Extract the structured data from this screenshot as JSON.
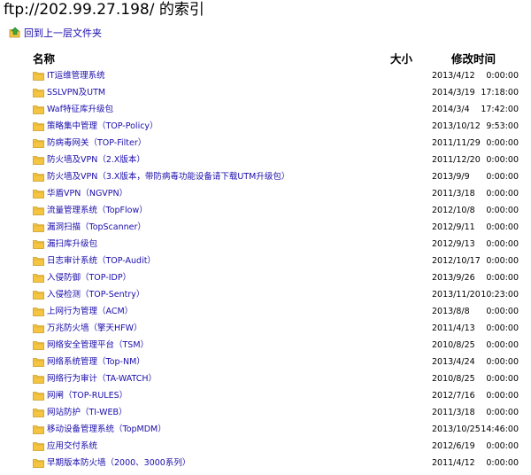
{
  "page": {
    "title": "ftp://202.99.27.198/ 的索引",
    "up_label": "回到上一层文件夹"
  },
  "columns": {
    "name": "名称",
    "size": "大小",
    "modified": "修改时间"
  },
  "icons": {
    "folder": "folder-icon",
    "up": "parent-folder-icon",
    "folder_color": "#f5c542",
    "link_color": "#1a0dab"
  },
  "rows": [
    {
      "name": "IT运维管理系统",
      "date": "2013/4/12",
      "time": "0:00:00"
    },
    {
      "name": "SSLVPN及UTM",
      "date": "2014/3/19",
      "time": "17:18:00"
    },
    {
      "name": "Waf特征库升级包",
      "date": "2014/3/4",
      "time": "17:42:00"
    },
    {
      "name": "策略集中管理（TOP-Policy）",
      "date": "2013/10/12",
      "time": "9:53:00"
    },
    {
      "name": "防病毒网关（TOP-Filter）",
      "date": "2011/11/29",
      "time": "0:00:00"
    },
    {
      "name": "防火墙及VPN（2.X版本）",
      "date": "2011/12/20",
      "time": "0:00:00"
    },
    {
      "name": "防火墙及VPN（3.X版本，带防病毒功能设备请下载UTM升级包）",
      "date": "2013/9/9",
      "time": "0:00:00"
    },
    {
      "name": "华盾VPN（NGVPN）",
      "date": "2011/3/18",
      "time": "0:00:00"
    },
    {
      "name": "流量管理系统（TopFlow）",
      "date": "2012/10/8",
      "time": "0:00:00"
    },
    {
      "name": "漏洞扫描（TopScanner）",
      "date": "2012/9/11",
      "time": "0:00:00"
    },
    {
      "name": "漏扫库升级包",
      "date": "2012/9/13",
      "time": "0:00:00"
    },
    {
      "name": "日志审计系统（TOP-Audit）",
      "date": "2012/10/17",
      "time": "0:00:00"
    },
    {
      "name": "入侵防御（TOP-IDP）",
      "date": "2013/9/26",
      "time": "0:00:00"
    },
    {
      "name": "入侵检测（TOP-Sentry）",
      "date": "2013/11/20",
      "time": "10:23:00"
    },
    {
      "name": "上网行为管理（ACM）",
      "date": "2013/8/8",
      "time": "0:00:00"
    },
    {
      "name": "万兆防火墙（擎天HFW）",
      "date": "2011/4/13",
      "time": "0:00:00"
    },
    {
      "name": "网络安全管理平台（TSM）",
      "date": "2010/8/25",
      "time": "0:00:00"
    },
    {
      "name": "网络系统管理（Top-NM）",
      "date": "2013/4/24",
      "time": "0:00:00"
    },
    {
      "name": "网络行为审计（TA-WATCH）",
      "date": "2010/8/25",
      "time": "0:00:00"
    },
    {
      "name": "网闸（TOP-RULES）",
      "date": "2012/7/16",
      "time": "0:00:00"
    },
    {
      "name": "网站防护（TI-WEB）",
      "date": "2011/3/18",
      "time": "0:00:00"
    },
    {
      "name": "移动设备管理系统（TopMDM）",
      "date": "2013/10/25",
      "time": "14:46:00"
    },
    {
      "name": "应用交付系统",
      "date": "2012/6/19",
      "time": "0:00:00"
    },
    {
      "name": "早期版本防火墙（2000、3000系列）",
      "date": "2011/4/12",
      "time": "0:00:00"
    }
  ]
}
